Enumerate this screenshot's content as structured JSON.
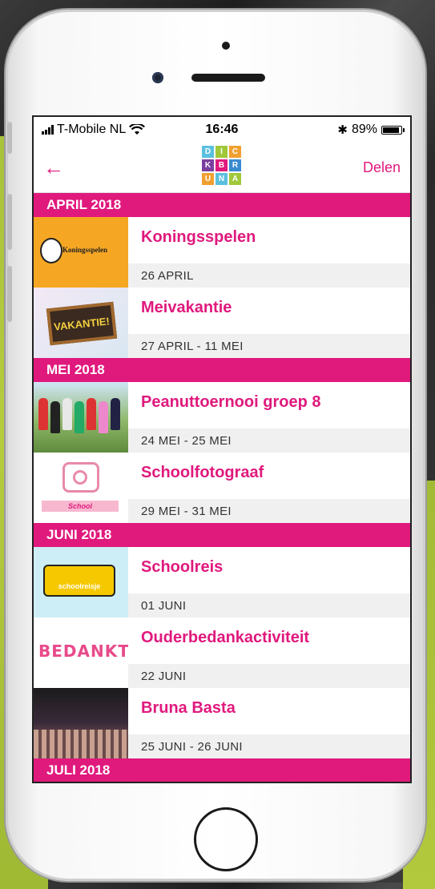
{
  "status_bar": {
    "carrier": "T-Mobile NL",
    "time": "16:46",
    "battery": "89%"
  },
  "nav": {
    "back_icon": "arrow-left-icon",
    "share_label": "Delen",
    "logo_letters": [
      "D",
      "I",
      "C",
      "K",
      "B",
      "R",
      "U",
      "N",
      "A"
    ],
    "logo_colors": [
      "#5bc0de",
      "#a0c83a",
      "#f0a030",
      "#7b3fa0",
      "#e0197d",
      "#3a8ad0",
      "#f0a030",
      "#5bc0de",
      "#a0c83a"
    ]
  },
  "accent_color": "#e0197d",
  "months": [
    {
      "label": "APRIL 2018",
      "events": [
        {
          "title": "Koningsspelen",
          "date": "26 APRIL",
          "thumb_text": "Koningsspelen"
        },
        {
          "title": "Meivakantie",
          "date": "27 APRIL - 11 MEI",
          "thumb_text": "VAKANTIE!"
        }
      ]
    },
    {
      "label": "MEI 2018",
      "events": [
        {
          "title": "Peanuttoernooi groep 8",
          "date": "24 MEI - 25 MEI",
          "thumb_text": ""
        },
        {
          "title": "Schoolfotograaf",
          "date": "29 MEI - 31 MEI",
          "thumb_text": "School"
        }
      ]
    },
    {
      "label": "JUNI 2018",
      "events": [
        {
          "title": "Schoolreis",
          "date": "01 JUNI",
          "thumb_text": "schoolreisje"
        },
        {
          "title": "Ouderbedankactiviteit",
          "date": "22 JUNI",
          "thumb_text": "BEDANKT"
        },
        {
          "title": "Bruna Basta",
          "date": "25 JUNI - 26 JUNI",
          "thumb_text": ""
        }
      ]
    },
    {
      "label": "JULI 2018",
      "events": []
    }
  ]
}
